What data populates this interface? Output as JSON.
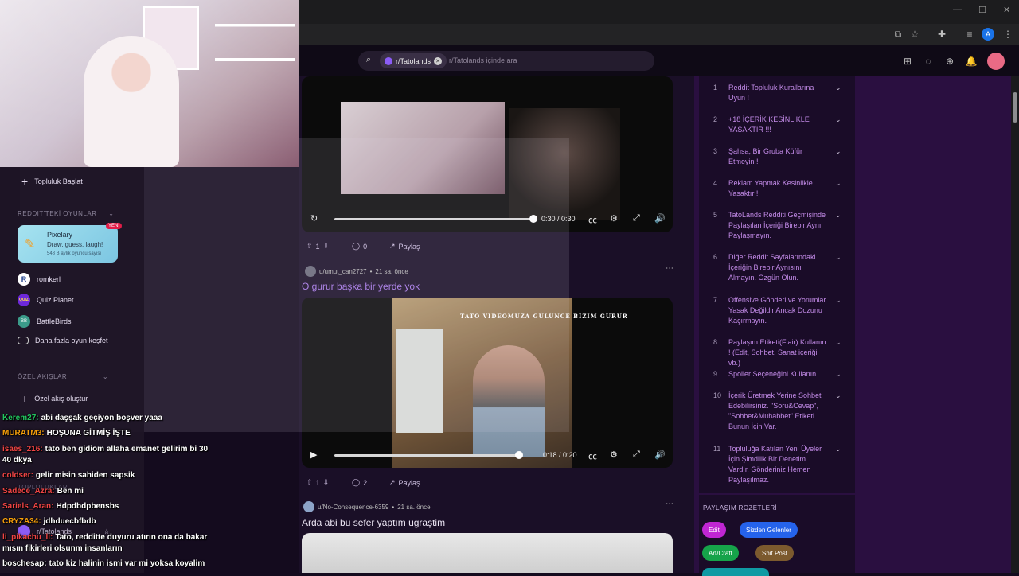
{
  "search": {
    "chip_label": "r/Tatolands",
    "placeholder": "r/Tatolands içinde ara"
  },
  "posts": [
    {
      "time_current": "0:30",
      "time_total": "0:30",
      "progress": 1.0,
      "upvotes": "1",
      "comments": "0",
      "share": "Paylaş"
    },
    {
      "author": "u/umut_can2727",
      "age": "21 sa. önce",
      "title": "O gurur başka bir yerde yok",
      "video_caption": "TATO VIDEOMUZA GÜLÜNCE BIZIM GURUR",
      "time": "0:18 / 0:20",
      "progress": 0.9,
      "upvotes": "1",
      "comments": "2",
      "share": "Paylaş"
    },
    {
      "author": "u/No-Consequence-6359",
      "age": "21 sa. önce",
      "title": "Arda abi bu sefer yaptım ugraştim"
    }
  ],
  "rules": [
    {
      "num": "1",
      "text": "Reddit Topluluk Kurallarına Uyun !"
    },
    {
      "num": "2",
      "text": "+18 İÇERİK KESİNLİKLE YASAKTIR !!!"
    },
    {
      "num": "3",
      "text": "Şahsa, Bir Gruba Küfür Etmeyin !"
    },
    {
      "num": "4",
      "text": "Reklam Yapmak Kesinlikle Yasaktır !"
    },
    {
      "num": "5",
      "text": "TatoLands Redditi Geçmişinde Paylaşılan İçeriği Birebir Aynı Paylaşmayın."
    },
    {
      "num": "6",
      "text": "Diğer Reddit Sayfalarındaki İçeriğin Birebir Aynısını Almayın. Özgün Olun."
    },
    {
      "num": "7",
      "text": "Offensive Gönderi ve Yorumlar Yasak Değildir Ancak Dozunu Kaçırmayın."
    },
    {
      "num": "8",
      "text": "Paylaşım Etiketi(Flair) Kullanın ! (Edit, Sohbet, Sanat içeriği vb.)"
    },
    {
      "num": "9",
      "text": "Spoiler Seçeneğini Kullanın."
    },
    {
      "num": "10",
      "text": "İçerik Üretmek Yerine Sohbet Edebilirsiniz. \"Soru&Cevap\", \"Sohbet&Muhabbet\" Etiketi Bunun İçin Var."
    },
    {
      "num": "11",
      "text": "Topluluğa Katılan Yeni Üyeler İçin Şimdilik Bir Denetim Vardır. Gönderiniz Hemen Paylaşılmaz."
    }
  ],
  "badges": {
    "title": "PAYLAŞIM ROZETLERİ",
    "items": [
      {
        "label": "Edit",
        "color": "#c026d3"
      },
      {
        "label": "Sizden Gelenler",
        "color": "#2563eb"
      },
      {
        "label": "Art/Craft",
        "color": "#16a34a"
      },
      {
        "label": "Shit Post",
        "color": "#7c5a2e"
      }
    ]
  },
  "sidebar": {
    "start_community": "Topluluk Başlat",
    "games_section": "REDDIT'TEKİ OYUNLAR",
    "featured_game": {
      "name": "Pixelary",
      "desc": "Draw, guess, laugh!",
      "meta": "548 B aylık oyuncu sayısı",
      "badge": "YENİ"
    },
    "games": [
      {
        "name": "romkerl",
        "icon": "R"
      },
      {
        "name": "Quiz Planet",
        "icon": "QUIZ"
      },
      {
        "name": "BattleBirds",
        "icon": "BB"
      }
    ],
    "discover": "Daha fazla oyun keşfet",
    "feeds_section": "ÖZEL AKIŞLAR",
    "create_feed": "Özel akış oluştur",
    "communities_section": "TOPLULUKLAR",
    "community": "r/Tatolands"
  },
  "chat": [
    {
      "user": "Kerem27:",
      "color": "#22c55e",
      "msg": "abi daşşak geçiyon boşver yaaa"
    },
    {
      "user": "MURATM3:",
      "color": "#f59e0b",
      "msg": "HOŞUNA GİTMİŞ İŞTE"
    },
    {
      "user": "isaes_216:",
      "color": "#ef4444",
      "msg": "tato ben gidiom allaha emanet gelirim bi 30"
    },
    {
      "user": "",
      "color": "#ffffff",
      "msg": "40 dkya"
    },
    {
      "user": "coldser:",
      "color": "#ef4444",
      "msg": "gelir misin sahiden sapsik"
    },
    {
      "user": "Sadece_Azra:",
      "color": "#ef4444",
      "msg": "Ben mi"
    },
    {
      "user": "Sariels_Aran:",
      "color": "#ef4444",
      "msg": "Hdpdbdpbensbs"
    },
    {
      "user": "CRYZA34:",
      "color": "#f59e0b",
      "msg": "jdhduecbfbdb"
    },
    {
      "user": "li_pikachu_li:",
      "color": "#ef4444",
      "msg": "Tato, redditte duyuru atırın ona da bakar"
    },
    {
      "user": "",
      "color": "#ffffff",
      "msg": "mısın fikirleri olsunm insanların"
    },
    {
      "user": "boschesap:",
      "color": "#ffffff",
      "msg": "tato kiz halinin ismi var mi yoksa koyalim"
    }
  ]
}
